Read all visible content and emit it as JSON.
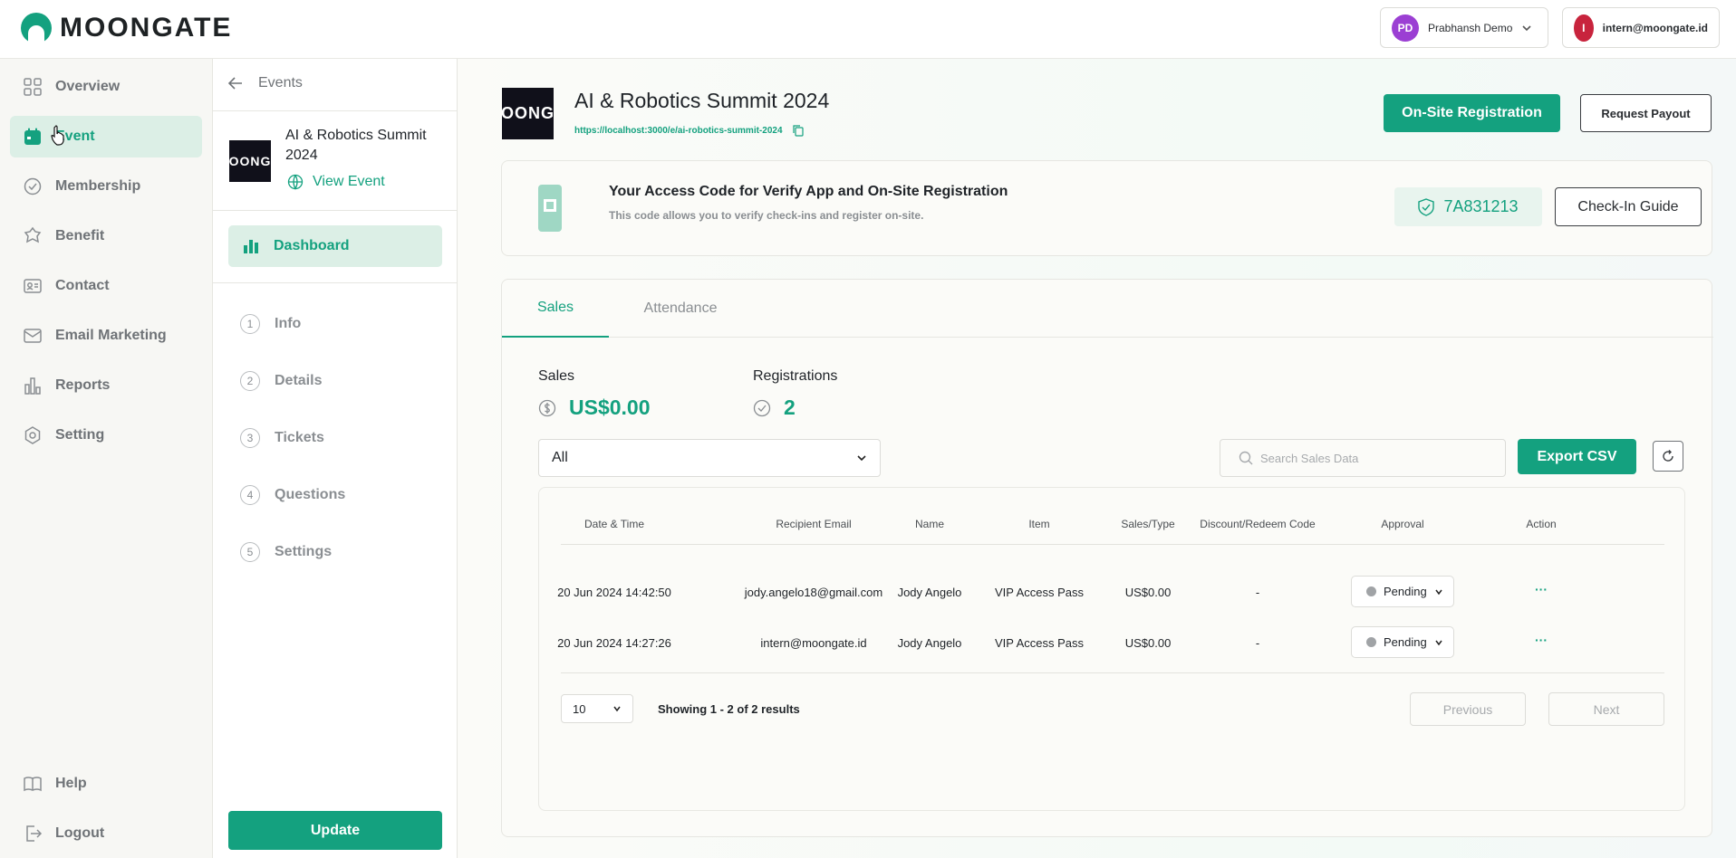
{
  "brand": {
    "name": "MOONGATE"
  },
  "header": {
    "workspace": {
      "initials": "PD",
      "name": "Prabhansh Demo",
      "color": "#9b3fd3"
    },
    "account": {
      "initials": "I",
      "email": "intern@moongate.id",
      "color": "#c8243d"
    }
  },
  "sidebar": {
    "items": [
      {
        "label": "Overview",
        "icon": "grid-icon"
      },
      {
        "label": "Event",
        "icon": "calendar-icon"
      },
      {
        "label": "Membership",
        "icon": "badge-check-icon"
      },
      {
        "label": "Benefit",
        "icon": "gift-icon"
      },
      {
        "label": "Contact",
        "icon": "contact-card-icon"
      },
      {
        "label": "Email Marketing",
        "icon": "mail-icon"
      },
      {
        "label": "Reports",
        "icon": "bar-chart-icon"
      },
      {
        "label": "Setting",
        "icon": "gear-icon"
      }
    ],
    "footer": [
      {
        "label": "Help",
        "icon": "book-icon"
      },
      {
        "label": "Logout",
        "icon": "logout-icon"
      }
    ]
  },
  "subnav": {
    "back_label": "Events",
    "event_title": "AI & Robotics Summit 2024",
    "view_event": "View Event",
    "thumb_text": "OONG",
    "dashboard": "Dashboard",
    "steps": [
      {
        "num": "1",
        "label": "Info"
      },
      {
        "num": "2",
        "label": "Details"
      },
      {
        "num": "3",
        "label": "Tickets"
      },
      {
        "num": "4",
        "label": "Questions"
      },
      {
        "num": "5",
        "label": "Settings"
      }
    ],
    "update": "Update"
  },
  "event": {
    "title": "AI & Robotics Summit 2024",
    "url": "https://localhost:3000/e/ai-robotics-summit-2024",
    "onsite_button": "On-Site Registration",
    "payout_button": "Request Payout"
  },
  "access": {
    "title": "Your Access Code for Verify App and On-Site Registration",
    "subtitle": "This code allows you to verify check-ins and register on-site.",
    "code": "7A831213",
    "guide_button": "Check-In Guide"
  },
  "tabs": [
    "Sales",
    "Attendance"
  ],
  "stats": {
    "sales_label": "Sales",
    "sales_value": "US$0.00",
    "reg_label": "Registrations",
    "reg_value": "2"
  },
  "filter": {
    "value": "All"
  },
  "search": {
    "placeholder": "Search Sales Data"
  },
  "export": "Export CSV",
  "table": {
    "columns": [
      "Date & Time",
      "Recipient Email",
      "Name",
      "Item",
      "Sales/Type",
      "Discount/Redeem Code",
      "Approval",
      "Action"
    ],
    "rows": [
      [
        "20 Jun 2024 14:42:50",
        "jody.angelo18@gmail.com",
        "Jody Angelo",
        "VIP Access Pass",
        "US$0.00",
        "-",
        "Pending",
        "···"
      ],
      [
        "20 Jun 2024 14:27:26",
        "intern@moongate.id",
        "Jody Angelo",
        "VIP Access Pass",
        "US$0.00",
        "-",
        "Pending",
        "···"
      ]
    ]
  },
  "pagination": {
    "per_page": "10",
    "summary": "Showing 1 - 2 of 2 results",
    "previous": "Previous",
    "next": "Next"
  },
  "colors": {
    "accent": "#14a17f",
    "accent_light": "#dcefe6"
  }
}
